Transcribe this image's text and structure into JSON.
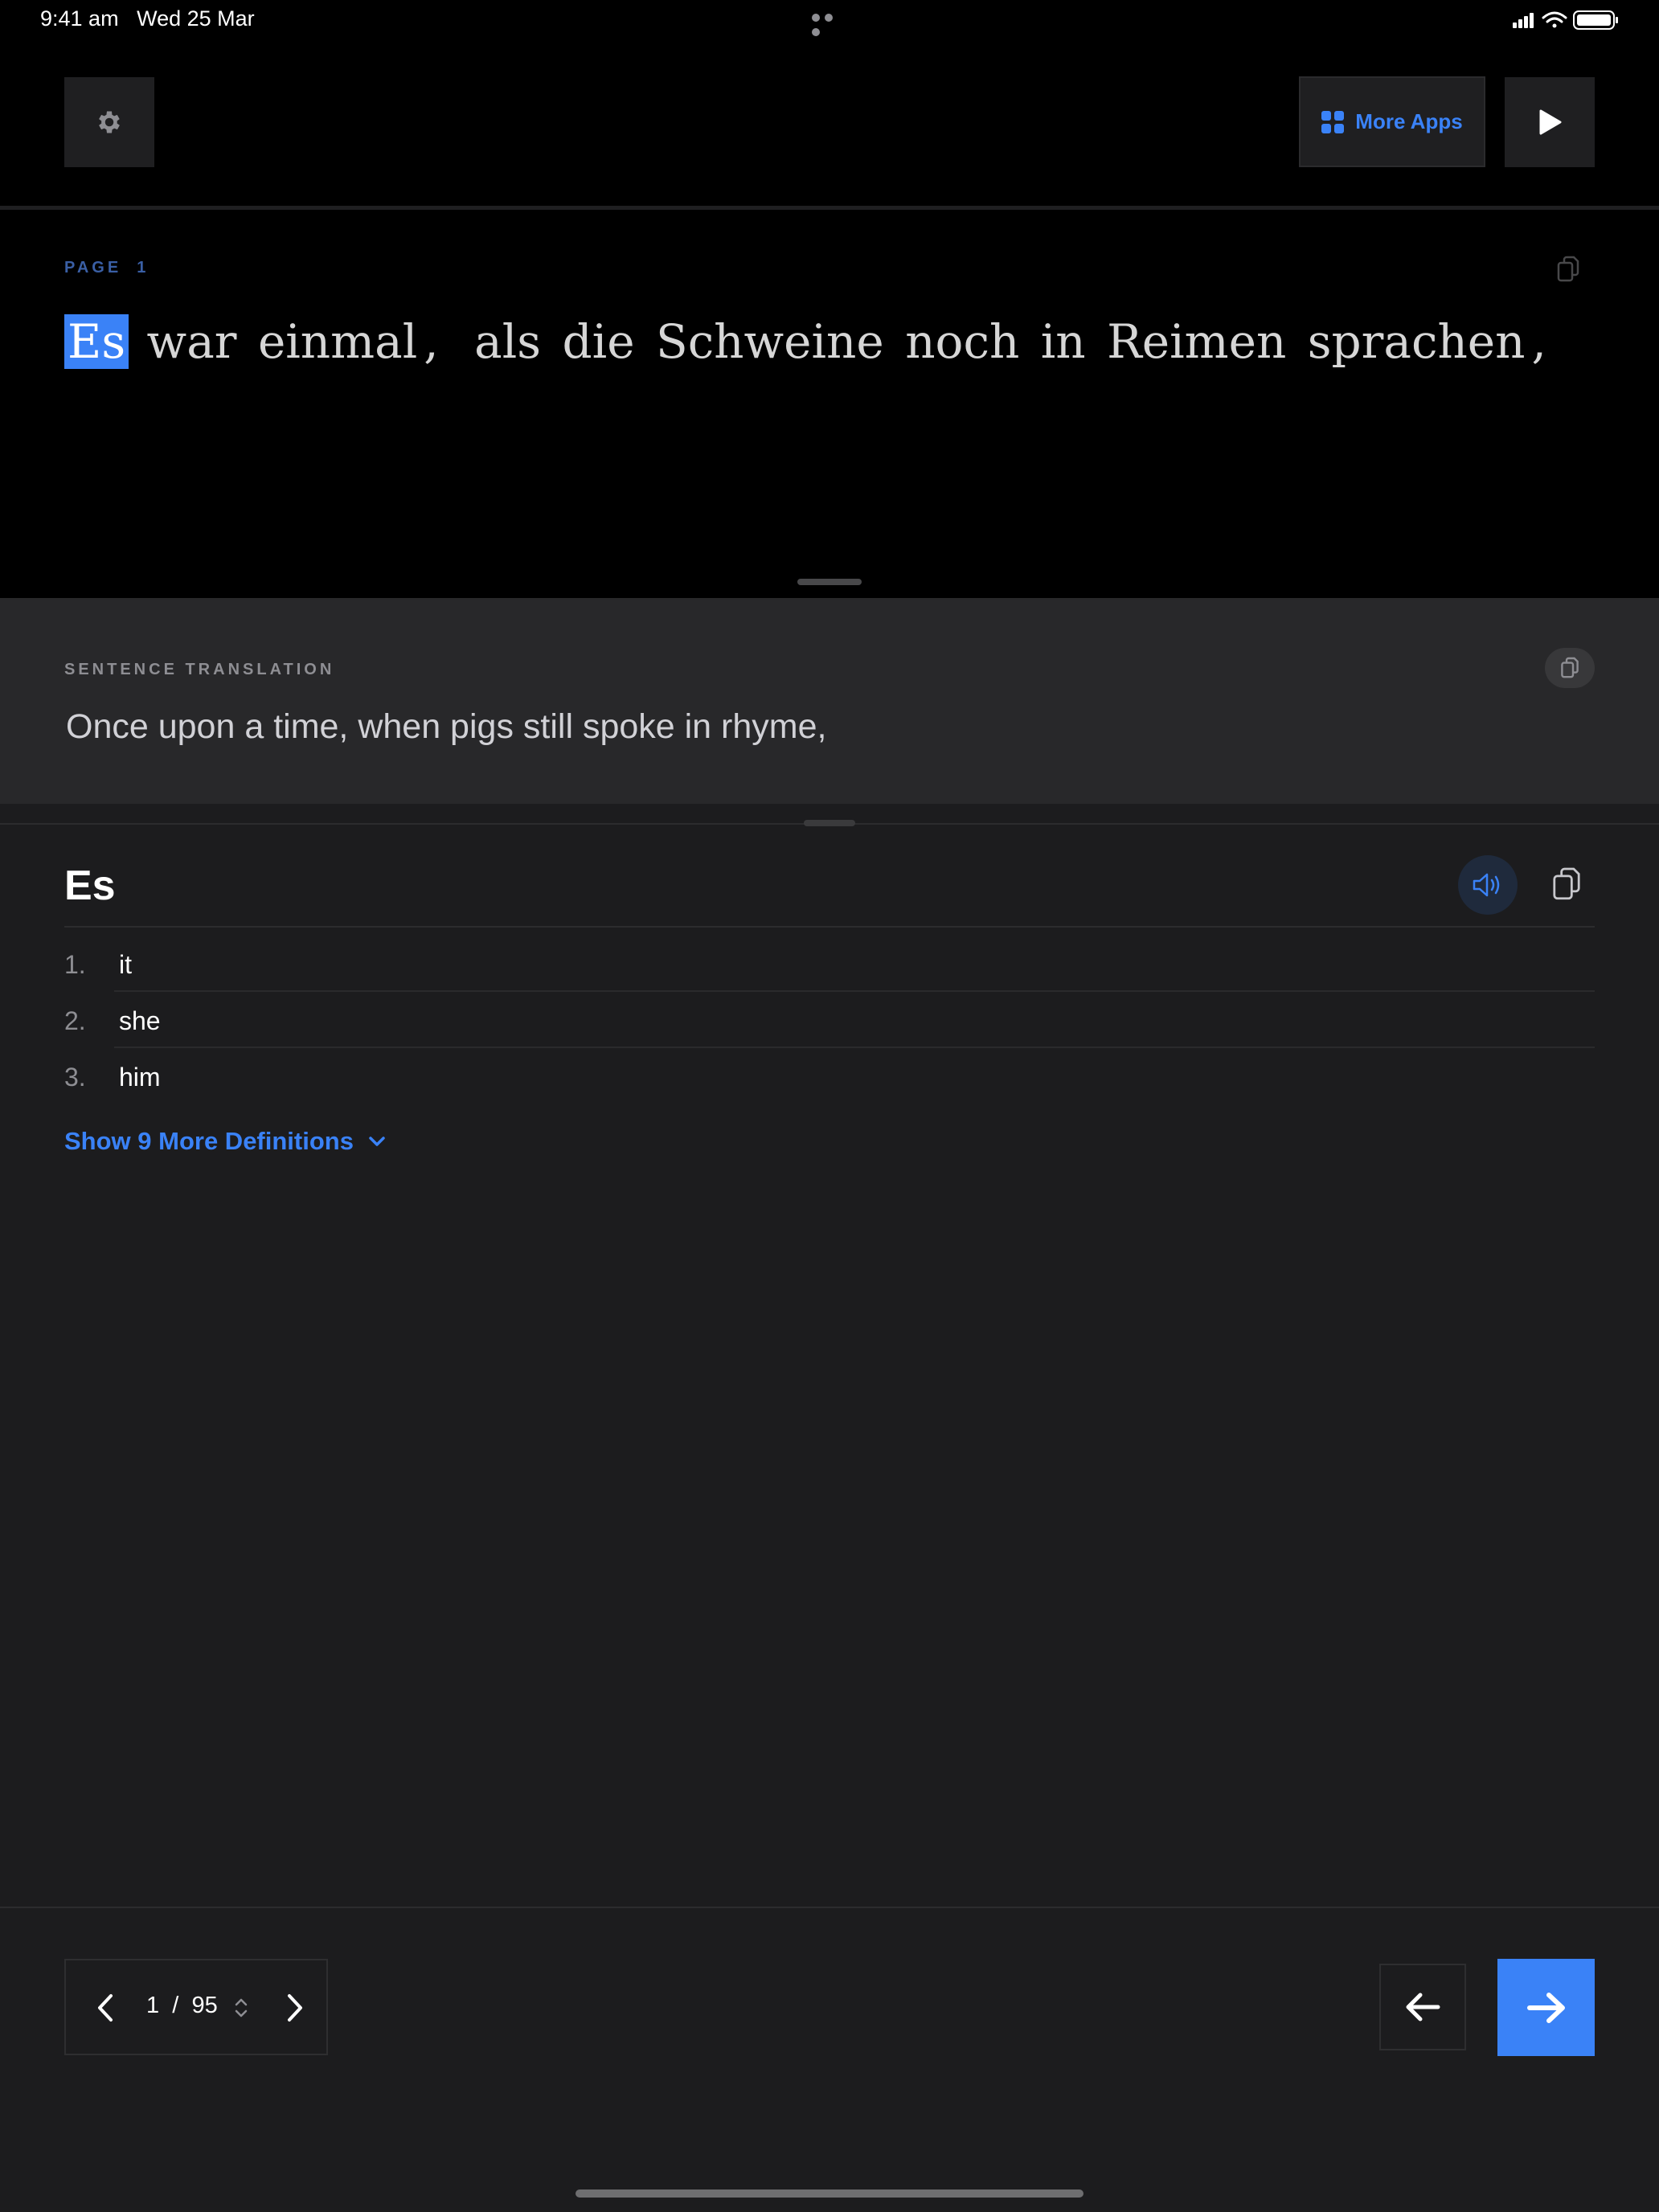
{
  "status_bar": {
    "time": "9:41 am",
    "date": "Wed 25 Mar",
    "icons": [
      "cellular-signal-icon",
      "wifi-icon",
      "battery-icon"
    ]
  },
  "toolbar": {
    "settings_icon": "gear-icon",
    "more_apps_label": "More Apps",
    "more_apps_icon": "grid-icon",
    "play_icon": "play-icon"
  },
  "reader": {
    "page_label": "PAGE  1",
    "sentence_words": [
      {
        "text": "Es",
        "selected": true
      },
      {
        "text": "war"
      },
      {
        "text": "einmal"
      },
      {
        "text": ","
      },
      {
        "text": "als"
      },
      {
        "text": "die"
      },
      {
        "text": "Schweine"
      },
      {
        "text": "noch"
      },
      {
        "text": "in"
      },
      {
        "text": "Reimen"
      },
      {
        "text": "sprachen"
      },
      {
        "text": ","
      }
    ]
  },
  "translation": {
    "label": "SENTENCE TRANSLATION",
    "text": "Once upon a time, when pigs still spoke in rhyme,"
  },
  "definitions": {
    "word": "Es",
    "items": [
      {
        "number": "1.",
        "text": "it"
      },
      {
        "number": "2.",
        "text": "she"
      },
      {
        "number": "3.",
        "text": "him"
      }
    ],
    "show_more_label": "Show 9 More Definitions"
  },
  "pagination": {
    "current": "1",
    "separator": "/",
    "total": "95"
  },
  "colors": {
    "accent": "#3a82f7",
    "background": "#1c1c1e",
    "top_background": "#000000"
  }
}
